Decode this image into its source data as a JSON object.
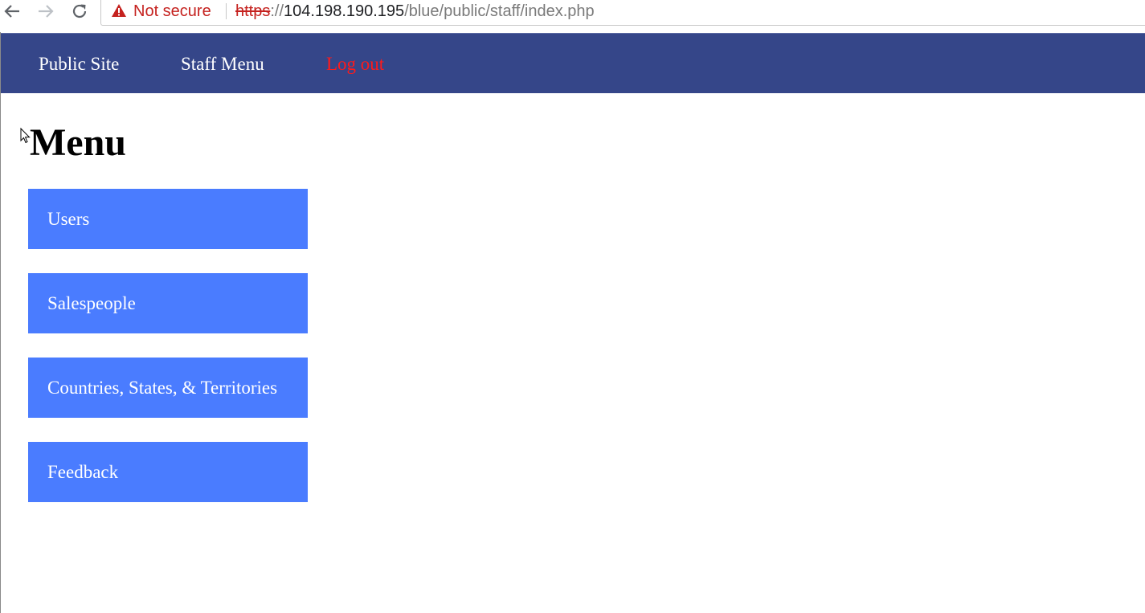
{
  "browser": {
    "security_label": "Not secure",
    "url": {
      "scheme": "https",
      "separator": "://",
      "host": "104.198.190.195",
      "path": "/blue/public/staff/index.php"
    },
    "icons": {
      "back": "arrow-left-icon",
      "forward": "arrow-right-icon",
      "reload": "reload-icon",
      "security": "warning-triangle-icon"
    }
  },
  "navbar": {
    "color": "#354689",
    "links": {
      "public_site": "Public Site",
      "staff_menu": "Staff Menu",
      "log_out": "Log out"
    },
    "logout_color": "#ff1a1a"
  },
  "main": {
    "title": "Menu",
    "menu": {
      "color": "#4a7cff",
      "items": [
        {
          "label": "Users"
        },
        {
          "label": "Salespeople"
        },
        {
          "label": "Countries, States, & Territories"
        },
        {
          "label": "Feedback"
        }
      ]
    }
  }
}
